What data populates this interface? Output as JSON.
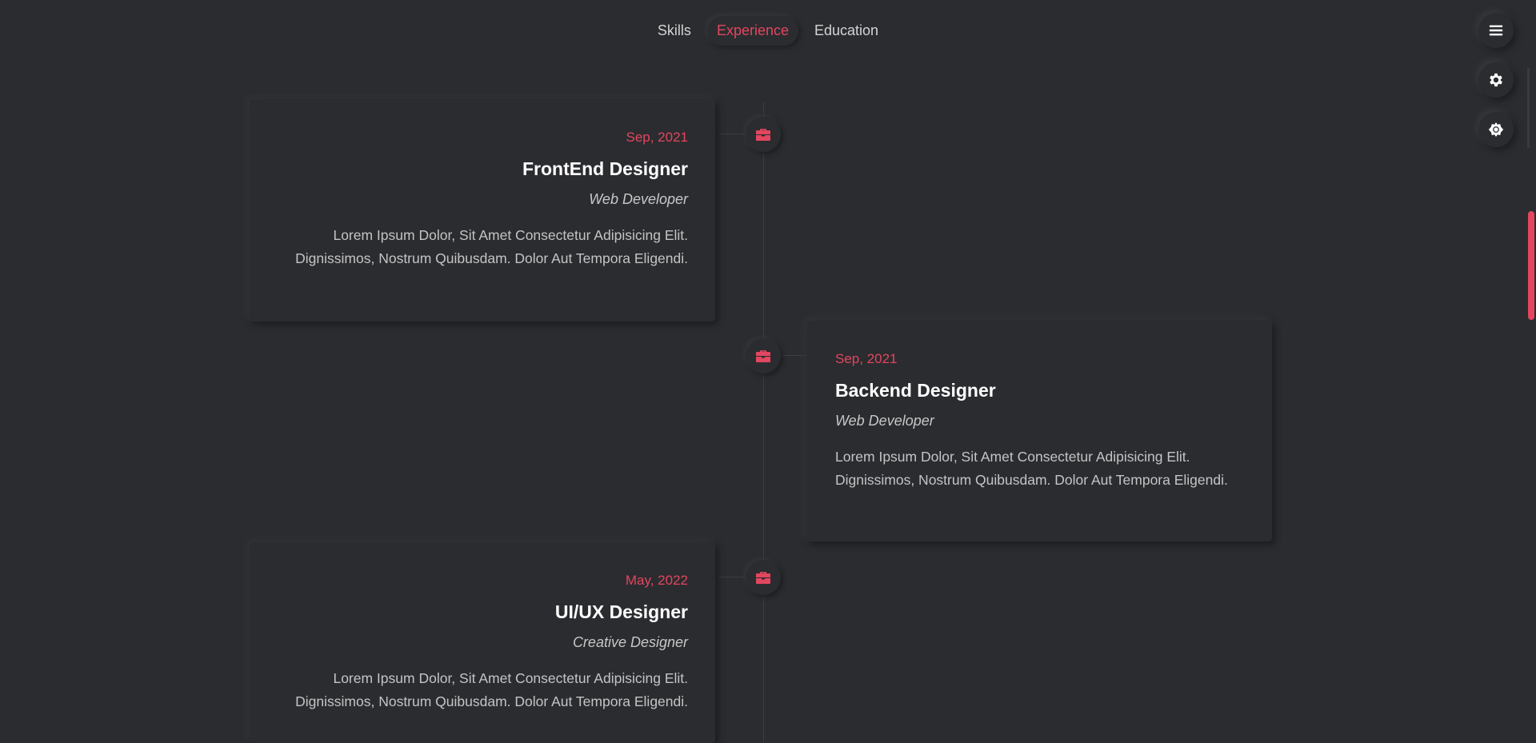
{
  "nav": {
    "tabs": [
      {
        "label": "Skills"
      },
      {
        "label": "Experience"
      },
      {
        "label": "Education"
      }
    ],
    "active_tab": "Experience"
  },
  "controls": {
    "menu_icon": "hamburger-menu-icon",
    "settings_icon": "gear-icon",
    "theme_icon": "sun-icon"
  },
  "timeline": [
    {
      "date": "Sep, 2021",
      "title": "FrontEnd Designer",
      "subtitle": "Web Developer",
      "description": "Lorem Ipsum Dolor, Sit Amet Consectetur Adipisicing Elit. Dignissimos, Nostrum Quibusdam. Dolor Aut Tempora Eligendi.",
      "icon": "briefcase-icon"
    },
    {
      "date": "Sep, 2021",
      "title": "Backend Designer",
      "subtitle": "Web Developer",
      "description": "Lorem Ipsum Dolor, Sit Amet Consectetur Adipisicing Elit. Dignissimos, Nostrum Quibusdam. Dolor Aut Tempora Eligendi.",
      "icon": "briefcase-icon"
    },
    {
      "date": "May, 2022",
      "title": "UI/UX Designer",
      "subtitle": "Creative Designer",
      "description": "Lorem Ipsum Dolor, Sit Amet Consectetur Adipisicing Elit. Dignissimos, Nostrum Quibusdam. Dolor Aut Tempora Eligendi.",
      "icon": "briefcase-icon"
    }
  ],
  "colors": {
    "background": "#2b2c30",
    "accent": "#e3465e",
    "heading": "#ffffff",
    "text": "#c4c4c4"
  }
}
